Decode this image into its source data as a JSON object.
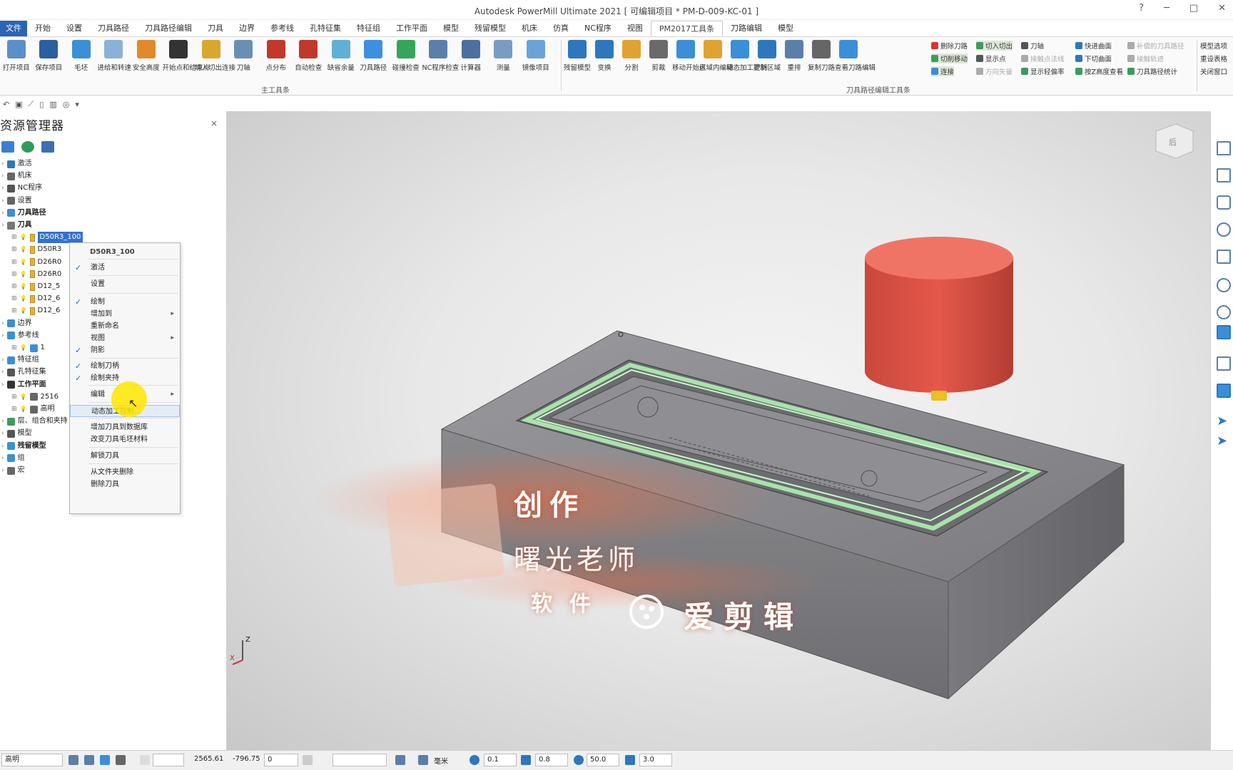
{
  "window": {
    "title": "Autodesk PowerMill Ultimate 2021    [ 可编辑项目 * PM-D-009-KC-01 ]",
    "help": "?",
    "minimize": "─",
    "maximize": "□",
    "close": "✕"
  },
  "menu": {
    "tabs": [
      "文件",
      "开始",
      "设置",
      "刀具路径",
      "刀具路径编辑",
      "刀具",
      "边界",
      "参考线",
      "孔特征集",
      "特征组",
      "工作平面",
      "模型",
      "残留模型",
      "机床",
      "仿真",
      "NC程序",
      "视图",
      "PM2017工具条",
      "刀路编辑",
      "模型"
    ],
    "active": "PM2017工具条"
  },
  "ribbon": {
    "main_group_label": "主工具条",
    "edit_group_label": "刀具路径编辑工具条",
    "main_buttons": [
      "打开项目",
      "保存项目",
      "毛坯",
      "进给和转速",
      "安全高度",
      "开始点和结束点",
      "切入切出连接",
      "刀轴",
      "点分布",
      "自动检查",
      "缺省余量",
      "刀具路径",
      "碰撞检查",
      "NC程序检查",
      "计算器",
      "测量",
      "镜像项目"
    ],
    "edit_buttons": [
      "残留模型",
      "变换",
      "分割",
      "剪裁",
      "移动开始点",
      "区域内编辑",
      "动态加工控制",
      "更新区域",
      "重排",
      "复制刀路",
      "查看刀路编辑"
    ],
    "small_col1": [
      "删除刀路",
      "切削移动",
      "连接"
    ],
    "small_col2": [
      "切入切出",
      "显示点",
      "方向矢量"
    ],
    "small_col3": [
      "刀轴",
      "接触点法线",
      "显示轻偏率"
    ],
    "small_col4": [
      "快进曲面",
      "下切曲面",
      "按Z高度查看"
    ],
    "small_col5": [
      "补偿的刀具路径",
      "接触轨迹",
      "刀具路径统计"
    ],
    "right_col": [
      "模型选项",
      "重设表格",
      "关闭窗口"
    ]
  },
  "explorer": {
    "title": "资源管理器",
    "close": "×",
    "tree": [
      "激活",
      "机床",
      "NC程序",
      "设置",
      "刀具路径",
      "刀具",
      "D50R3_100",
      "D50R3",
      "D26R0",
      "D26R0",
      "D12_5",
      "D12_6",
      "D12_6",
      "边界",
      "参考线",
      "1",
      "特征组",
      "孔特征集",
      "工作平面",
      "2516",
      "高明",
      "层、组合和夹持",
      "模型",
      "残留模型",
      "组",
      "宏"
    ]
  },
  "context_menu": {
    "header": "D50R3_100",
    "items": [
      "激活",
      "设置",
      "绘制",
      "增加到",
      "重新命名",
      "视图",
      "阴影",
      "绘制刀柄",
      "绘制夹持",
      "编辑",
      "动态加工控制...",
      "增加刀具到数据库",
      "改变刀具毛坯材料",
      "解锁刀具",
      "从文件夹删除",
      "删除刀具"
    ]
  },
  "overlay": {
    "line1": "创作",
    "line2": "曙光老师",
    "line3": "软件",
    "brand": "爱剪辑"
  },
  "viewcube_label": "后",
  "axis": {
    "z": "Z",
    "x": "X"
  },
  "status": {
    "workplane": "高明",
    "x": "2565.61",
    "y": "-796.75",
    "z": "0",
    "units": "毫米",
    "tol": "0.1",
    "stepover": "0.8",
    "diameter": "50.0",
    "angle": "3.0"
  },
  "colors": {
    "accent": "#2b64b6",
    "tool": "#e8695a",
    "model_top": "#8d8d91",
    "toolpath": "#9fe6a4"
  }
}
